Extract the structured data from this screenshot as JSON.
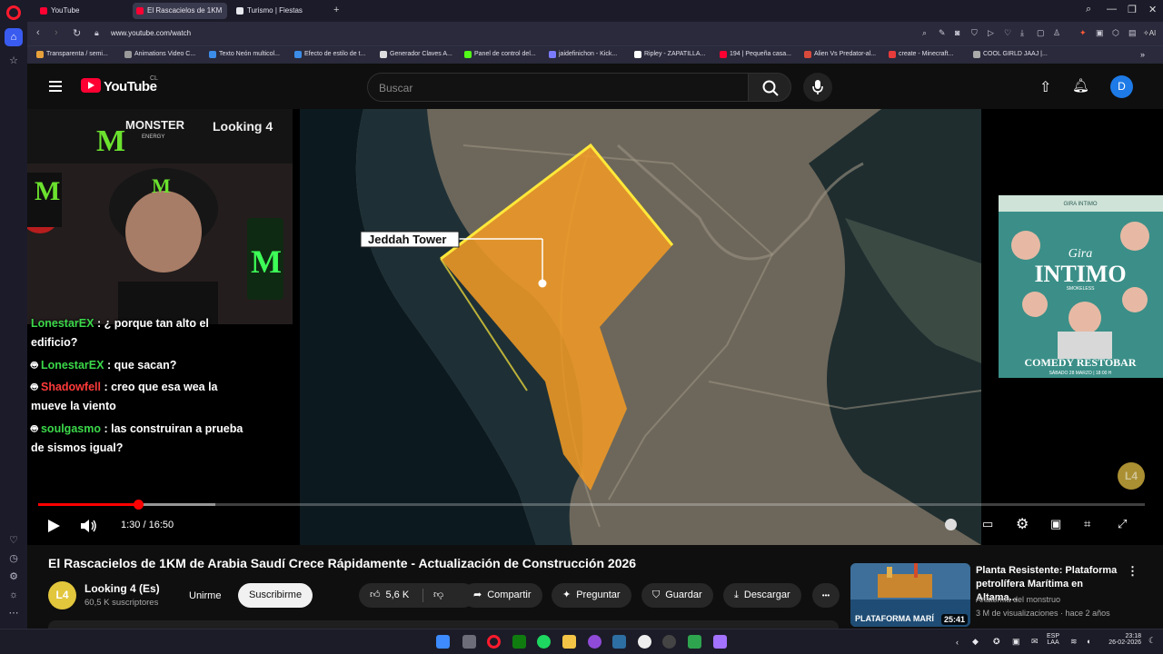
{
  "browser": {
    "tabs": [
      {
        "label": "YouTube",
        "active": false
      },
      {
        "label": "El Rascacielos de 1KM",
        "active": true
      },
      {
        "label": "Turismo | Fiestas",
        "active": false
      }
    ],
    "new_tab": "+",
    "url": "www.youtube.com/watch",
    "window_controls": {
      "search": "⌕",
      "minimize": "—",
      "restore": "❐",
      "close": "✕"
    },
    "ai_label": "AI",
    "bookmarks": [
      {
        "label": "Transparenta / semi...",
        "color": "#e8a23b"
      },
      {
        "label": "Animations Video C...",
        "color": "#9a9a9a"
      },
      {
        "label": "Texto Neón multicol...",
        "color": "#3b8de8"
      },
      {
        "label": "Efecto de estilo de t...",
        "color": "#3b8de8"
      },
      {
        "label": "Generador Claves A...",
        "color": "#dddddd"
      },
      {
        "label": "Panel de control del...",
        "color": "#53fc18"
      },
      {
        "label": "jaidefinichon - Kick...",
        "color": "#7b7bff"
      },
      {
        "label": "Ripley - ZAPATILLA...",
        "color": "#ffffff"
      },
      {
        "label": "194 | Pequeña casa...",
        "color": "#ff0033"
      },
      {
        "label": "Alien Vs Predator-al...",
        "color": "#d84a3b"
      },
      {
        "label": "create - Minecraft...",
        "color": "#e83b3b"
      },
      {
        "label": "COOL GIRLD JAAJ |...",
        "color": "#aaaaaa"
      }
    ]
  },
  "youtube": {
    "logo_text": "YouTube",
    "country_code": "CL",
    "search_placeholder": "Buscar",
    "avatar_letter": "D"
  },
  "player": {
    "map_label": "Jeddah Tower",
    "webcam_brand": "MONSTER",
    "webcam_brand_sub": "ENERGY",
    "webcam_overlay_text": "Looking 4",
    "chat": [
      {
        "user": "LonestarEX",
        "text": ": ¿ porque tan alto el edificio?"
      },
      {
        "user": "LonestarEX",
        "text": ": que sacan?"
      },
      {
        "user": "Shadowfell",
        "text": ": creo que esa wea la mueve la viento"
      },
      {
        "user": "soulgasmo",
        "text": ": las construiran a prueba de sismos igual?"
      }
    ],
    "poster": {
      "top_text": "GIRA INTIMO",
      "title_script": "Gira",
      "title": "INTIMO",
      "subtitle": "SMOKELESS",
      "venue": "COMEDY RESTOBAR",
      "date": "SÁBADO 28 MARZO | 18:00 H"
    },
    "progress": 0.09,
    "buffered": 0.16,
    "time_display": "1:30 / 16:50",
    "channel_badge": "L4"
  },
  "video": {
    "title": "El Rascacielos de 1KM de Arabia Saudí Crece Rápidamente - Actualización de Construcción 2026",
    "channel": {
      "name": "Looking 4 (Es)",
      "subscribers": "60,5 K suscriptores",
      "avatar": "L4"
    },
    "buttons": {
      "join": "Unirme",
      "subscribe": "Suscribirme",
      "likes": "5,6 K",
      "share": "Compartir",
      "ask": "Preguntar",
      "save": "Guardar",
      "download": "Descargar",
      "more": "•••"
    }
  },
  "recommendation": {
    "title": "Planta Resistente: Plataforma petrolífera Marítima en Altama...",
    "channel": "Anatomía del monstruo",
    "meta": "3 M de visualizaciones · hace 2 años",
    "thumb_text": "PLATAFORMA MARÍ",
    "duration": "25:41"
  },
  "taskbar": {
    "lang_line1": "ESP",
    "lang_line2": "LAA",
    "time": "23:18",
    "date": "26-02-2026"
  }
}
